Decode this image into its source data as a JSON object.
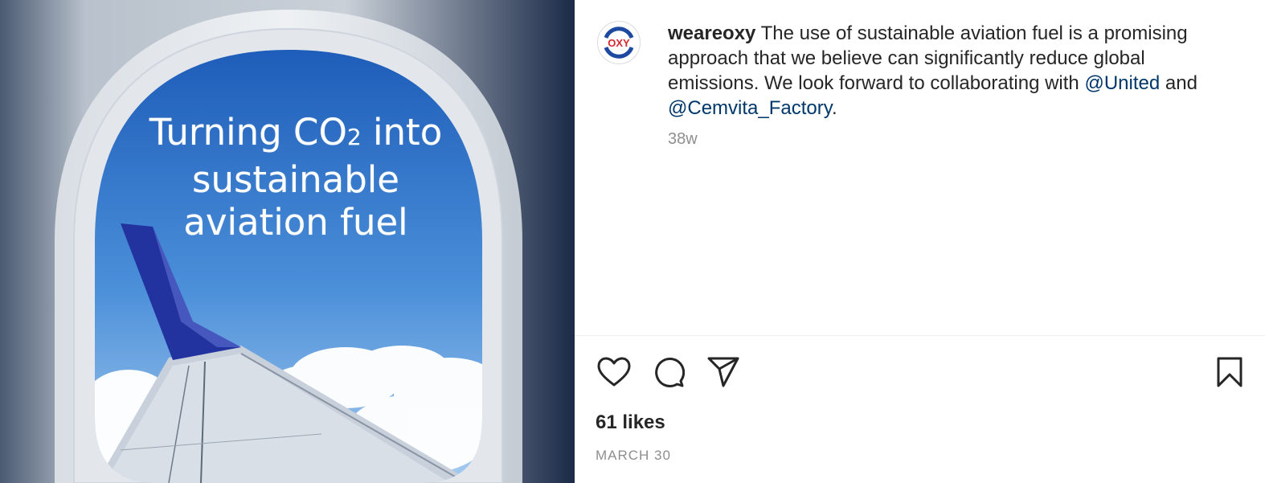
{
  "post": {
    "image_headline_before": "Turning CO",
    "image_headline_subscript": "2",
    "image_headline_after": " into",
    "image_headline_line2": "sustainable",
    "image_headline_line3": "aviation fuel"
  },
  "author": {
    "username": "weareoxy",
    "avatar_text": "OXY",
    "avatar_colors": {
      "red": "#d7282f",
      "blue": "#1d4aa0"
    }
  },
  "caption": {
    "text_1": " The use of sustainable aviation fuel is a promising approach that we believe can significantly reduce global emissions. We look forward to collaborating with ",
    "mention_1": "@United",
    "text_2": " and ",
    "mention_2": "@Cemvita_Factory",
    "text_3": "."
  },
  "meta": {
    "age": "38w",
    "likes": "61 likes",
    "date": "MARCH 30"
  },
  "icons": {
    "like": "heart-icon",
    "comment": "comment-icon",
    "share": "paper-plane-icon",
    "save": "bookmark-icon"
  },
  "colors": {
    "mention": "#00376b",
    "muted": "#8e8e8e",
    "text": "#262626"
  }
}
